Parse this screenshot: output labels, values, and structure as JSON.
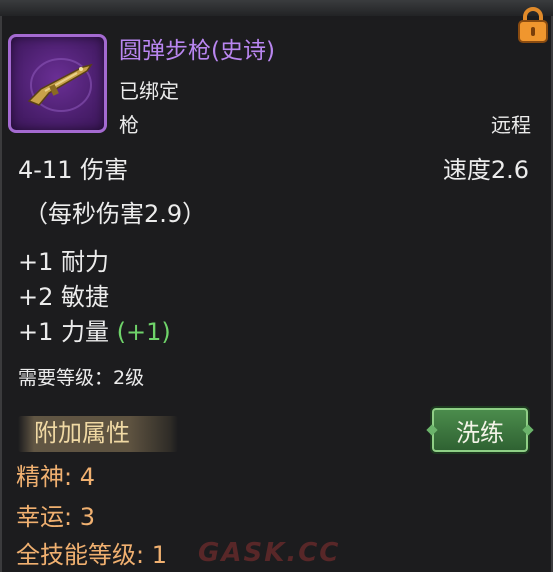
{
  "item": {
    "name": "圆弹步枪(史诗)",
    "bind_status": "已绑定",
    "type": "枪",
    "range_type": "远程",
    "damage": "4-11 伤害",
    "speed": "速度2.6",
    "dps": "（每秒伤害2.9）",
    "rarity_color": "#b986f0",
    "icon": "rifle-icon"
  },
  "stats": [
    {
      "text": "+1 耐力",
      "bonus": ""
    },
    {
      "text": "+2 敏捷",
      "bonus": ""
    },
    {
      "text": "+1 力量",
      "bonus": "(+1)"
    }
  ],
  "requirement": "需要等级：2级",
  "extra_section": {
    "title": "附加属性",
    "reroll_label": "洗练",
    "attributes": [
      {
        "text": "精神: 4"
      },
      {
        "text": "幸运: 3"
      },
      {
        "text": "全技能等级: 1"
      }
    ]
  },
  "lock_icon": "lock-icon",
  "watermark": "GASK.CC"
}
